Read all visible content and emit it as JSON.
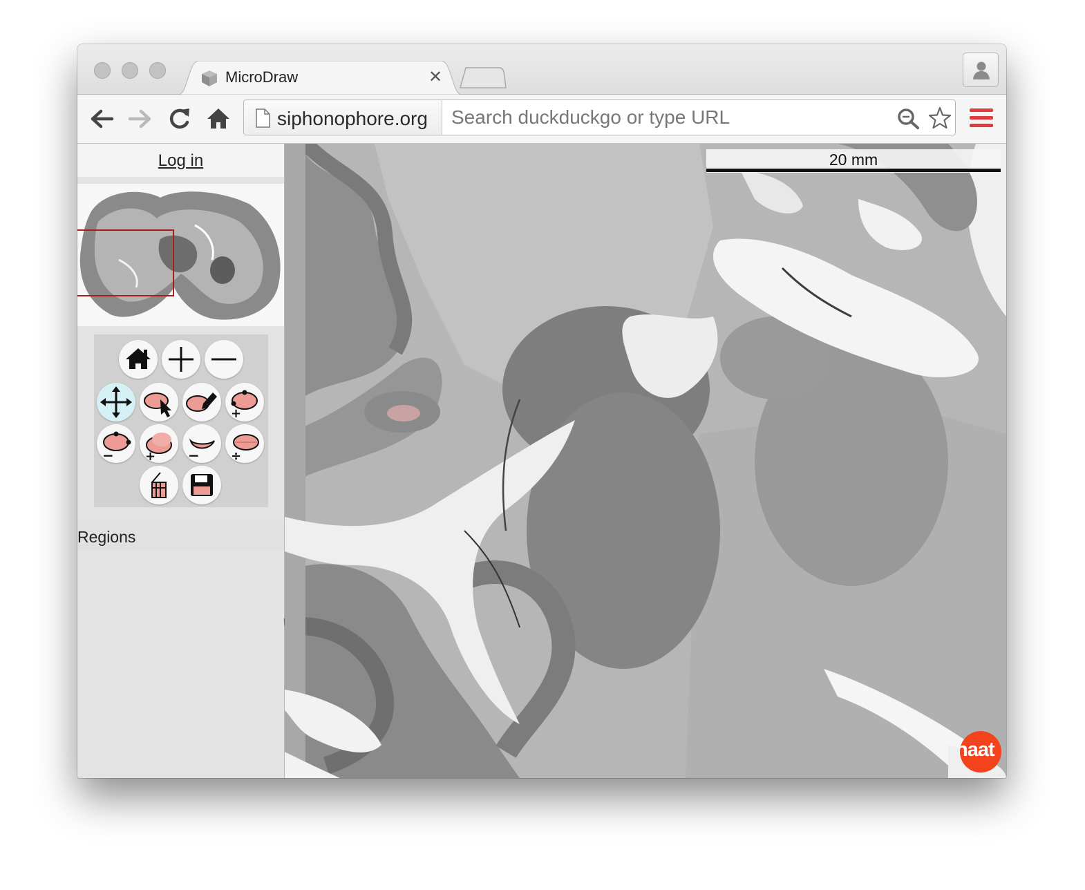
{
  "browser": {
    "tab": {
      "title": "MicroDraw"
    },
    "address_bar": {
      "origin": "siphonophore.org",
      "placeholder": "Search duckduckgo or type URL"
    },
    "icons": [
      "back-arrow-icon",
      "forward-arrow-icon",
      "reload-icon",
      "home-icon",
      "page-icon",
      "search-icon",
      "star-icon",
      "hamburger-menu-icon",
      "profile-icon"
    ],
    "menu_color": "#e23b3b"
  },
  "sidebar": {
    "login_label": "Log in",
    "regions_label": "Regions",
    "tools": {
      "navigation": [
        "home-icon",
        "zoom-in-icon",
        "zoom-out-icon"
      ],
      "drawing": [
        "move-icon",
        "select-region-icon",
        "draw-icon",
        "add-point-icon",
        "delete-point-icon",
        "union-icon",
        "subtract-icon",
        "split-icon",
        "measure-icon",
        "save-icon"
      ],
      "selected": "move-icon"
    },
    "navigator_highlight_color": "#a81e1e"
  },
  "viewer": {
    "scale_bar": "20 mm",
    "logo_text": "naat",
    "logo_color": "#f2431c"
  }
}
